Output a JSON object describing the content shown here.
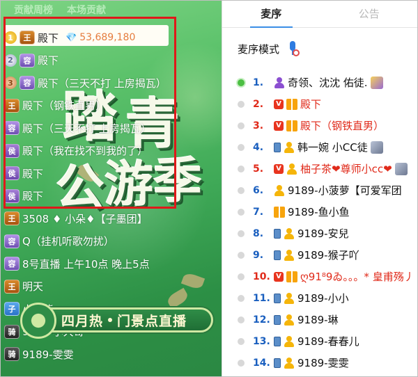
{
  "left_panel": {
    "tabs": [
      "贡献周榜",
      "本场贡献"
    ],
    "ranking": [
      {
        "medal": "1",
        "level": "王",
        "name": "殿下",
        "gem": "💎",
        "value": "53,689,180"
      },
      {
        "medal": "2",
        "level": "容",
        "name": "殿下"
      },
      {
        "medal": "3",
        "level": "容",
        "name": "殿下（三天不打 上房揭瓦）"
      },
      {
        "level": "王",
        "name": "殿下（钢铁直男）"
      },
      {
        "level": "容",
        "name": "殿下（三天不打 上房揭瓦）"
      },
      {
        "level": "侯",
        "name": "殿下（我在找不到我的了）"
      },
      {
        "level": "侯",
        "name": "殿下"
      },
      {
        "level": "侯",
        "name": "殿下"
      },
      {
        "level": "王",
        "name": "3508 ♦ 小朵♦【子墨团】"
      },
      {
        "level": "容",
        "name": "Q（挂机听歌勿扰）"
      },
      {
        "level": "容",
        "name": "8号直播 上午10点 晚上5点"
      },
      {
        "level": "王",
        "name": "明天"
      },
      {
        "level": "子",
        "name": "小阿紫"
      },
      {
        "level": "骑",
        "name": "9189-小大哥"
      },
      {
        "level": "骑",
        "name": "9189-雯雯"
      }
    ],
    "promo": {
      "art_chars": [
        "踏",
        "青",
        "公",
        "游",
        "季"
      ],
      "banner_left": "四月热",
      "banner_right": "门景点直播"
    }
  },
  "right_panel": {
    "tabs": [
      {
        "label": "麦序",
        "active": true
      },
      {
        "label": "公告",
        "active": false
      }
    ],
    "mode_label": "麦序模式",
    "queue": [
      {
        "num": "1.",
        "name": "奇领、沈沈 佑徒.",
        "red": false,
        "online": true
      },
      {
        "num": "2.",
        "name": "殿下",
        "red": true
      },
      {
        "num": "3.",
        "name": "殿下（钢铁直男）",
        "red": true
      },
      {
        "num": "4.",
        "name": "韩一婉 小CC徒",
        "red": false
      },
      {
        "num": "5.",
        "name": "柚子茶❤尊师小cc❤",
        "red": true
      },
      {
        "num": "6.",
        "name": "9189-小菠萝【可爱军团",
        "red": false
      },
      {
        "num": "7.",
        "name": "9189-鱼小鱼",
        "red": false
      },
      {
        "num": "8.",
        "name": "9189-安兒",
        "red": false
      },
      {
        "num": "9.",
        "name": "9189-猴子吖",
        "red": false
      },
      {
        "num": "10.",
        "name": "ღ91⁸9ゐ。。。* 皇甫殇丿",
        "red": true
      },
      {
        "num": "11.",
        "name": "9189-小小",
        "red": false
      },
      {
        "num": "12.",
        "name": "9189-琳",
        "red": false
      },
      {
        "num": "13.",
        "name": "9189-春春儿",
        "red": false
      },
      {
        "num": "14.",
        "name": "9189-雯雯",
        "red": false
      }
    ]
  }
}
